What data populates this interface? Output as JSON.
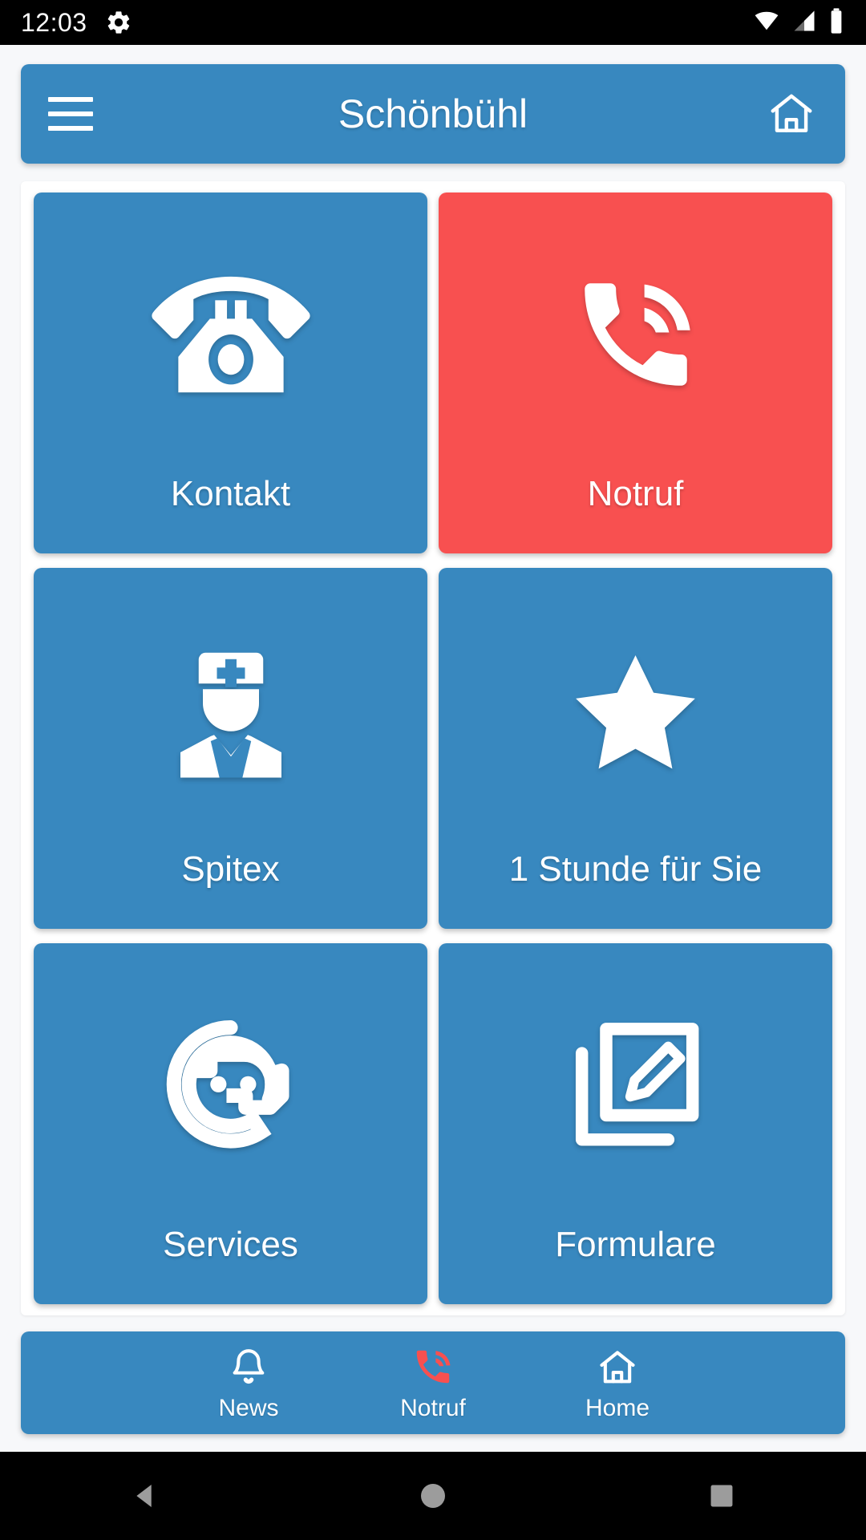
{
  "statusbar": {
    "time": "12:03",
    "icons": [
      "gear-icon",
      "wifi-icon",
      "cellular-signal-icon",
      "battery-icon"
    ]
  },
  "topbar": {
    "title": "Schönbühl",
    "menu_icon": "hamburger-menu-icon",
    "home_icon": "home-icon"
  },
  "colors": {
    "primary_blue": "#3888bf",
    "emergency_red": "#f85050",
    "panel_white": "#ffffff",
    "page_background": "#f7f8fa",
    "statusbar_black": "#000000"
  },
  "tiles": [
    {
      "label": "Kontakt",
      "icon": "desk-phone-icon",
      "color": "#3888bf"
    },
    {
      "label": "Notruf",
      "icon": "phone-in-talk-icon",
      "color": "#f85050"
    },
    {
      "label": "Spitex",
      "icon": "nurse-icon",
      "color": "#3888bf"
    },
    {
      "label": "1 Stunde für Sie",
      "icon": "star-icon",
      "color": "#3888bf"
    },
    {
      "label": "Services",
      "icon": "headset-face-icon",
      "color": "#3888bf"
    },
    {
      "label": "Formulare",
      "icon": "note-edit-icon",
      "color": "#3888bf"
    }
  ],
  "bottomnav": [
    {
      "label": "News",
      "icon": "bell-icon",
      "icon_color": "#ffffff"
    },
    {
      "label": "Notruf",
      "icon": "phone-in-talk-icon",
      "icon_color": "#f85050"
    },
    {
      "label": "Home",
      "icon": "home-outline-icon",
      "icon_color": "#ffffff"
    }
  ],
  "sysnav": [
    {
      "name": "back-button",
      "icon": "triangle-left-icon"
    },
    {
      "name": "home-button",
      "icon": "circle-icon"
    },
    {
      "name": "recents-button",
      "icon": "square-icon"
    }
  ]
}
